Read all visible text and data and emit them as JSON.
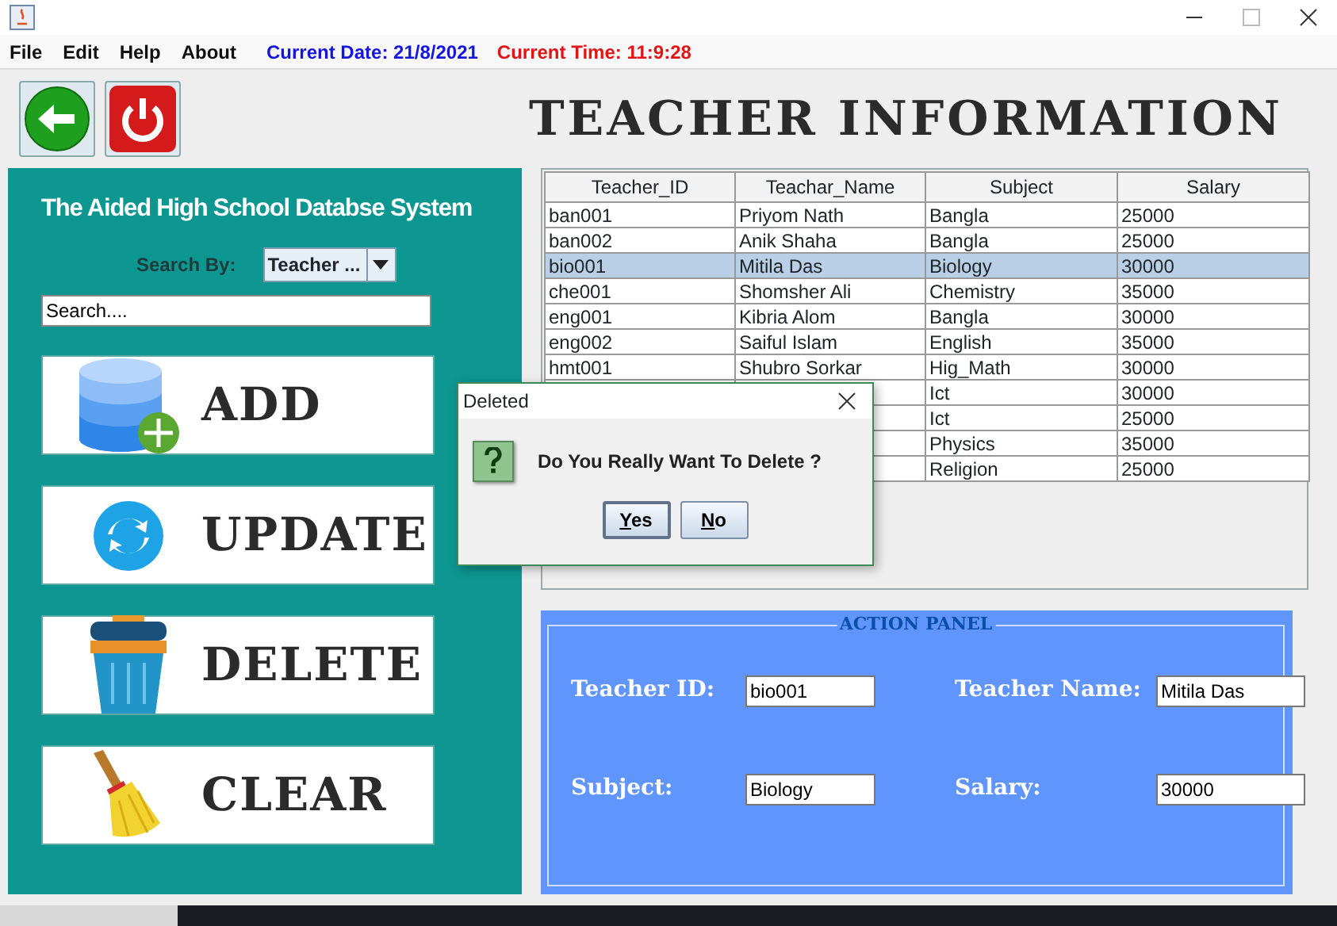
{
  "menu": [
    "File",
    "Edit",
    "Help",
    "About"
  ],
  "date_text": "Current Date: 21/8/2021",
  "time_text": "Current Time: 11:9:28",
  "page_title": "TEACHER INFORMATION",
  "side_panel": {
    "heading": "The Aided High School Databse System",
    "search_by_label": "Search By:",
    "search_by_value": "Teacher ...",
    "search_value": "Search....",
    "actions": [
      {
        "kind": "add",
        "label": "ADD"
      },
      {
        "kind": "update",
        "label": "UPDATE"
      },
      {
        "kind": "delete",
        "label": "DELETE"
      },
      {
        "kind": "clear",
        "label": "CLEAR"
      }
    ]
  },
  "table": {
    "columns": [
      "Teacher_ID",
      "Teachar_Name",
      "Subject",
      "Salary"
    ],
    "rows": [
      {
        "id": "ban001",
        "name": "Priyom Nath",
        "subject": "Bangla",
        "salary": "25000",
        "selected": false
      },
      {
        "id": "ban002",
        "name": "Anik Shaha",
        "subject": "Bangla",
        "salary": "25000",
        "selected": false
      },
      {
        "id": "bio001",
        "name": "Mitila Das",
        "subject": "Biology",
        "salary": "30000",
        "selected": true
      },
      {
        "id": "che001",
        "name": "Shomsher Ali",
        "subject": "Chemistry",
        "salary": "35000",
        "selected": false
      },
      {
        "id": "eng001",
        "name": "Kibria Alom",
        "subject": "Bangla",
        "salary": "30000",
        "selected": false
      },
      {
        "id": "eng002",
        "name": "Saiful Islam",
        "subject": "English",
        "salary": "35000",
        "selected": false
      },
      {
        "id": "hmt001",
        "name": "Shubro Sorkar",
        "subject": "Hig_Math",
        "salary": "30000",
        "selected": false
      },
      {
        "subject": "Ict",
        "salary": "30000",
        "selected": false
      },
      {
        "subject": "Ict",
        "salary": "25000",
        "selected": false
      },
      {
        "subject": "Physics",
        "salary": "35000",
        "selected": false
      },
      {
        "subject": "Religion",
        "salary": "25000",
        "selected": false
      }
    ]
  },
  "action_panel": {
    "title": "ACTION PANEL",
    "fields": [
      {
        "label": "Teacher ID:",
        "value": "bio001"
      },
      {
        "label": "Teacher Name:",
        "value": "Mitila Das"
      },
      {
        "label": "Subject:",
        "value": "Biology"
      },
      {
        "label": "Salary:",
        "value": "30000"
      }
    ]
  },
  "dialog": {
    "title": "Deleted",
    "message": "Do You Really Want To Delete ?",
    "buttons": [
      {
        "label": "Yes",
        "focused": true
      },
      {
        "label": "No",
        "focused": false
      }
    ]
  }
}
